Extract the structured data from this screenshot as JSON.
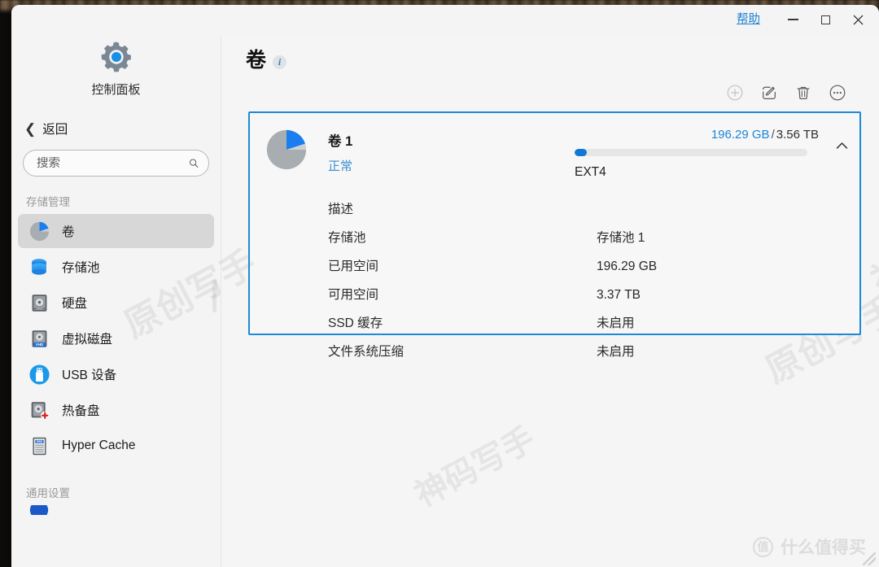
{
  "window": {
    "help_label": "帮助",
    "minimize_label": "最小化",
    "maximize_label": "最大化",
    "close_label": "关闭"
  },
  "sidebar": {
    "brand_label": "控制面板",
    "brand_icon": "gear-icon",
    "back_label": "返回",
    "back_icon": "chevron-left-icon",
    "search": {
      "value": "",
      "placeholder": "搜索",
      "icon": "search-icon"
    },
    "sections": [
      {
        "title": "存储管理",
        "items": [
          {
            "label": "卷",
            "icon": "pie-volume-icon",
            "active": true
          },
          {
            "label": "存储池",
            "icon": "database-stack-icon",
            "active": false
          },
          {
            "label": "硬盘",
            "icon": "hard-disk-icon",
            "active": false
          },
          {
            "label": "虚拟磁盘",
            "icon": "virtual-disk-vhd-icon",
            "active": false
          },
          {
            "label": "USB 设备",
            "icon": "usb-device-icon",
            "active": false
          },
          {
            "label": "热备盘",
            "icon": "hot-spare-disk-icon",
            "active": false
          },
          {
            "label": "Hyper Cache",
            "icon": "ssd-cache-icon",
            "active": false
          }
        ]
      },
      {
        "title": "通用设置",
        "items": []
      }
    ]
  },
  "main": {
    "title": "卷",
    "info_icon": "info-icon",
    "toolbar": [
      {
        "name": "add-volume-button",
        "icon": "plus-circle-icon",
        "label": "创建",
        "disabled": true
      },
      {
        "name": "edit-volume-button",
        "icon": "edit-pencil-icon",
        "label": "编辑",
        "disabled": false
      },
      {
        "name": "delete-volume-button",
        "icon": "trash-icon",
        "label": "删除",
        "disabled": false
      },
      {
        "name": "more-actions-button",
        "icon": "ellipsis-circle-icon",
        "label": "更多",
        "disabled": false
      }
    ],
    "volume_card": {
      "name": "卷 1",
      "status": "正常",
      "pie_icon": "pie-volume-icon",
      "used_display": "196.29 GB",
      "separator": "/",
      "total_display": "3.56 TB",
      "usage_percent": 5.4,
      "filesystem": "EXT4",
      "collapse_icon": "chevron-up-icon",
      "details": [
        {
          "key": "描述",
          "value": ""
        },
        {
          "key": "存储池",
          "value": "存储池 1"
        },
        {
          "key": "已用空间",
          "value": "196.29 GB"
        },
        {
          "key": "可用空间",
          "value": "3.37 TB"
        },
        {
          "key": "SSD 缓存",
          "value": "未启用"
        },
        {
          "key": "文件系统压缩",
          "value": "未启用"
        }
      ]
    }
  },
  "watermarks": {
    "tiles": [
      "神码写手",
      "原创写手",
      "神码写手",
      "原创写手",
      "神码写手"
    ],
    "brand_logo": "值",
    "brand_text": "什么值得买"
  },
  "colors": {
    "accent_blue": "#1c8ad6",
    "link_blue": "#1a7fd4",
    "bar_blue": "#1278d4",
    "window_bg": "#f4f4f4",
    "sidebar_active": "#d7d7d7"
  }
}
